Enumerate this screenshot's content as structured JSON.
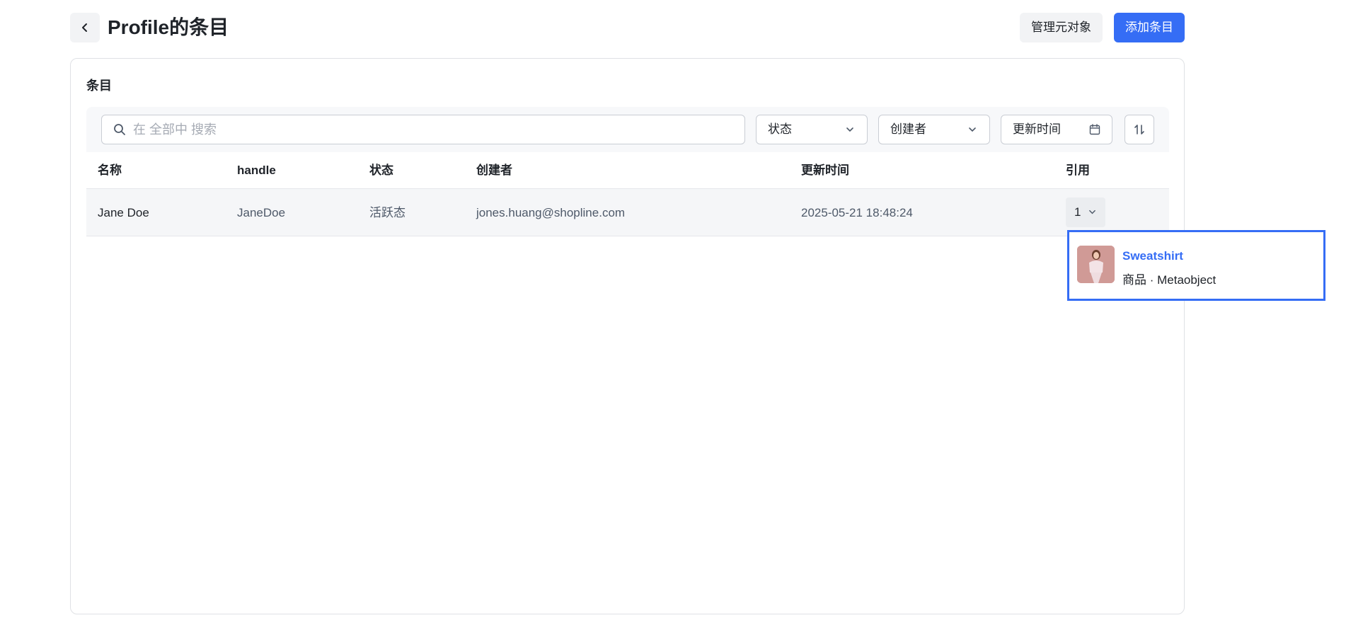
{
  "header": {
    "title": "Profile的条目",
    "manage_label": "管理元对象",
    "add_label": "添加条目"
  },
  "card": {
    "title": "条目"
  },
  "filters": {
    "search_placeholder": "在 全部中 搜索",
    "status_label": "状态",
    "creator_label": "创建者",
    "updated_label": "更新时间"
  },
  "table": {
    "columns": {
      "name": "名称",
      "handle": "handle",
      "status": "状态",
      "creator": "创建者",
      "updated": "更新时间",
      "refs": "引用"
    },
    "rows": [
      {
        "name": "Jane Doe",
        "handle": "JaneDoe",
        "status": "活跃态",
        "creator": "jones.huang@shopline.com",
        "updated": "2025-05-21 18:48:24",
        "refs": "1"
      }
    ]
  },
  "popover": {
    "title": "Sweatshirt",
    "subtitle": "商品 · Metaobject"
  },
  "colors": {
    "primary": "#356df5",
    "border": "#dfe1e5",
    "row_bg": "#f5f6f8"
  },
  "icons": [
    "chevron-left-icon",
    "search-icon",
    "chevron-down-icon",
    "calendar-icon",
    "sort-icon"
  ]
}
